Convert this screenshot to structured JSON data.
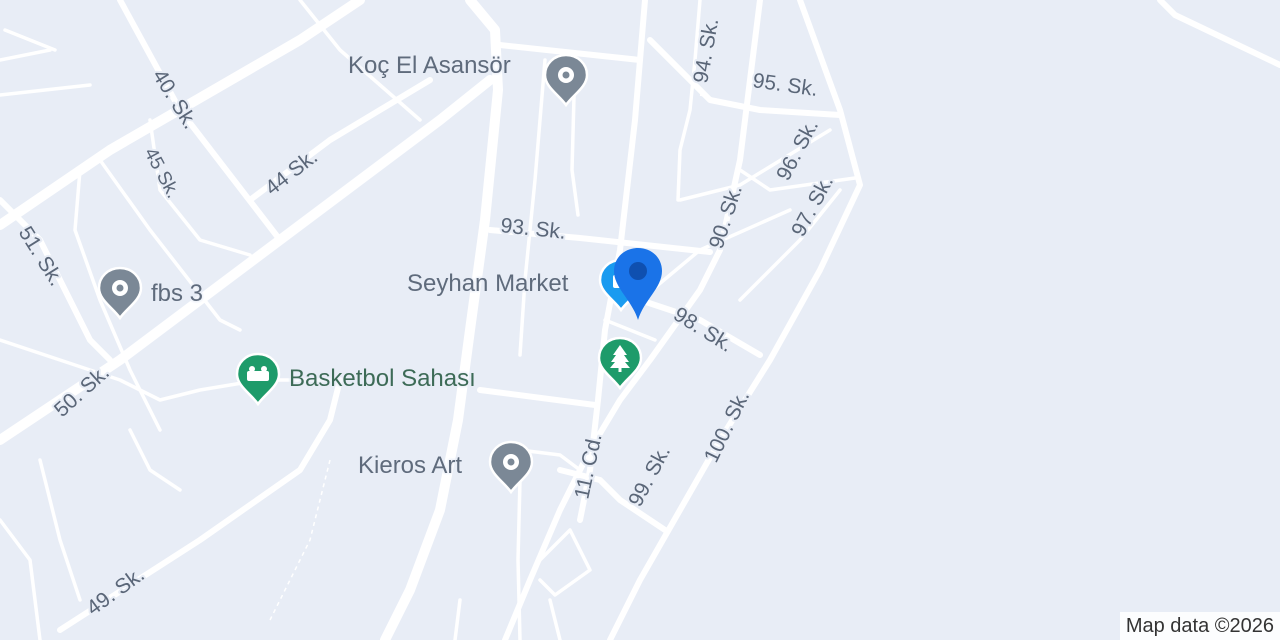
{
  "map": {
    "streets": [
      {
        "id": "s40",
        "label": "40. Sk."
      },
      {
        "id": "s45",
        "label": "45 Sk."
      },
      {
        "id": "s44",
        "label": "44 Sk."
      },
      {
        "id": "s51",
        "label": "51. Sk."
      },
      {
        "id": "s50",
        "label": "50. Sk."
      },
      {
        "id": "s49",
        "label": "49. Sk."
      },
      {
        "id": "s93",
        "label": "93. Sk."
      },
      {
        "id": "s94",
        "label": "94. Sk."
      },
      {
        "id": "s95",
        "label": "95. Sk."
      },
      {
        "id": "s96",
        "label": "96. Sk."
      },
      {
        "id": "s97",
        "label": "97. Sk."
      },
      {
        "id": "s90",
        "label": "90. Sk."
      },
      {
        "id": "s98",
        "label": "98. Sk."
      },
      {
        "id": "s99",
        "label": "99. Sk."
      },
      {
        "id": "s100",
        "label": "100. Sk."
      },
      {
        "id": "c11",
        "label": "11. Cd."
      }
    ],
    "places": [
      {
        "id": "koc",
        "label": "Koç El Asansör",
        "icon": "generic-place-pin-icon",
        "color": "#7b8896"
      },
      {
        "id": "fbs",
        "label": "fbs 3",
        "icon": "generic-place-pin-icon",
        "color": "#7b8896"
      },
      {
        "id": "seyhan",
        "label": "Seyhan Market",
        "icon": "shopping-bag-pin-icon",
        "color": "#1a9bf0"
      },
      {
        "id": "basket",
        "label": "Basketbol Sahası",
        "icon": "sports-pin-icon",
        "color": "#1e9b6a"
      },
      {
        "id": "park",
        "label": "",
        "icon": "tree-pin-icon",
        "color": "#1e9b6a"
      },
      {
        "id": "kieros",
        "label": "Kieros Art",
        "icon": "generic-place-pin-icon",
        "color": "#7b8896"
      }
    ],
    "marker": {
      "icon": "location-marker-icon",
      "color": "#1a73e8"
    },
    "attribution": "Map data ©2026"
  }
}
